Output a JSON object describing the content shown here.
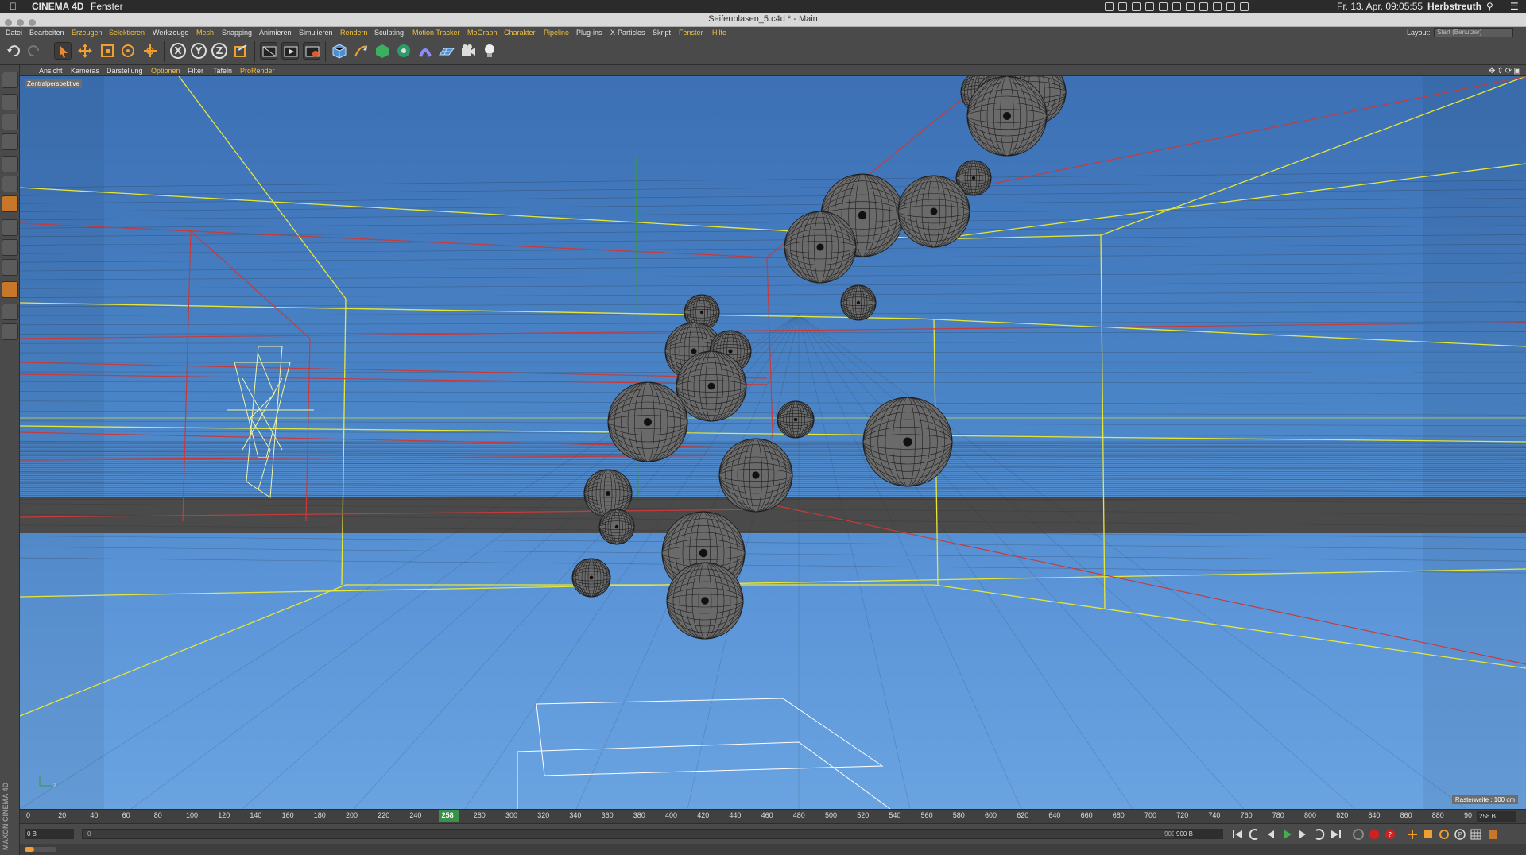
{
  "mac_menubar": {
    "app_name": "CINEMA 4D",
    "menu": "Fenster",
    "datetime": "Fr. 13. Apr.  09:05:55",
    "user": "Herbstreuth"
  },
  "window": {
    "title": "Seifenblasen_5.c4d * - Main"
  },
  "main_menu": {
    "items": [
      "Datei",
      "Bearbeiten",
      "Erzeugen",
      "Selektieren",
      "Werkzeuge",
      "Mesh",
      "Snapping",
      "Animieren",
      "Simulieren",
      "Rendern",
      "Sculpting",
      "Motion Tracker",
      "MoGraph",
      "Charakter",
      "Pipeline",
      "Plug-ins",
      "X-Particles",
      "Skript",
      "Fenster",
      "Hilfe"
    ],
    "highlighted": [
      "Erzeugen",
      "Selektieren",
      "Mesh",
      "Rendern",
      "Motion Tracker",
      "MoGraph",
      "Charakter",
      "Pipeline",
      "Fenster",
      "Hilfe"
    ],
    "layout_label": "Layout:",
    "layout_value": "Start (Benutzer)"
  },
  "viewport_menu": {
    "items": [
      "Ansicht",
      "Kameras",
      "Darstellung",
      "Optionen",
      "Filter",
      "Tafeln",
      "ProRender"
    ],
    "highlighted": [
      "Optionen",
      "ProRender"
    ]
  },
  "viewport": {
    "camera_label": "Zentralperspektive",
    "grid_info": "Rasterweite : 100 cm"
  },
  "timeline": {
    "ticks": [
      "0",
      "20",
      "40",
      "60",
      "80",
      "100",
      "120",
      "140",
      "160",
      "180",
      "200",
      "220",
      "240",
      "258",
      "280",
      "300",
      "320",
      "340",
      "360",
      "380",
      "400",
      "420",
      "440",
      "460",
      "480",
      "500",
      "520",
      "540",
      "560",
      "580",
      "600",
      "620",
      "640",
      "660",
      "680",
      "700",
      "720",
      "740",
      "760",
      "780",
      "800",
      "820",
      "840",
      "860",
      "880",
      "90"
    ],
    "current_frame": "258",
    "current_field": "258 B"
  },
  "playback": {
    "start_field": "0 B",
    "scrub_start": "0",
    "scrub_end": "900 B",
    "end_field": "900 B"
  },
  "branding": {
    "logo_text": "MAXON CINEMA 4D"
  },
  "colors": {
    "accent_menu": "#f0c040",
    "timeline_marker": "#3aa04a",
    "bounding_box": "#e6e63a",
    "spline_red": "#c83a3a",
    "sphere_fill": "#6a6a6a"
  }
}
